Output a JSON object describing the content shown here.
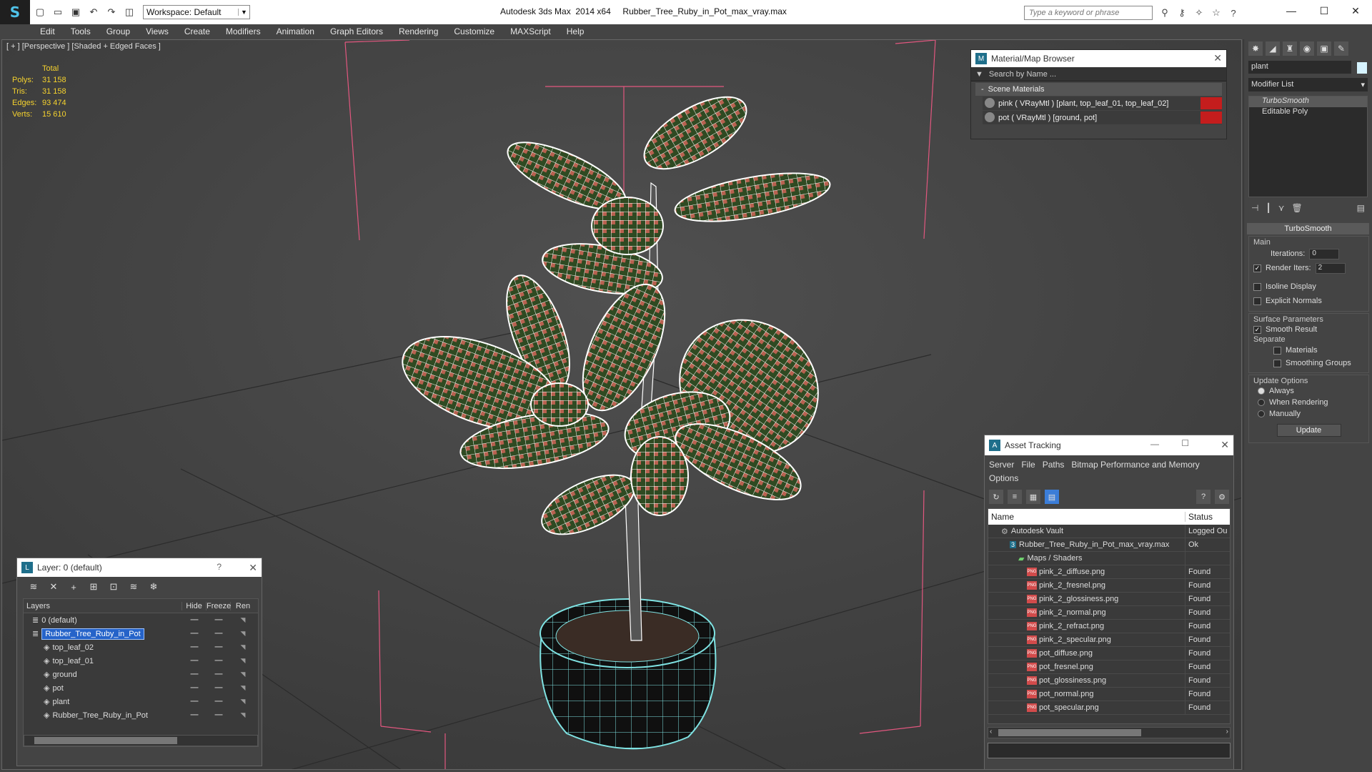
{
  "app": {
    "title": "Autodesk 3ds Max  2014 x64     Rubber_Tree_Ruby_in_Pot_max_vray.max",
    "workspace": "Workspace: Default",
    "search_placeholder": "Type a keyword or phrase"
  },
  "menu": [
    "Edit",
    "Tools",
    "Group",
    "Views",
    "Create",
    "Modifiers",
    "Animation",
    "Graph Editors",
    "Rendering",
    "Customize",
    "MAXScript",
    "Help"
  ],
  "viewport": {
    "label": "[ + ] [Perspective ] [Shaded + Edged Faces ]",
    "stats": {
      "total_label": "Total",
      "rows": [
        {
          "k": "Polys:",
          "v": "31 158"
        },
        {
          "k": "Tris:",
          "v": "31 158"
        },
        {
          "k": "Edges:",
          "v": "93 474"
        },
        {
          "k": "Verts:",
          "v": "15 610"
        }
      ]
    }
  },
  "material_browser": {
    "title": "Material/Map Browser",
    "search_placeholder": "Search by Name ...",
    "section": "Scene Materials",
    "items": [
      {
        "label": "pink  ( VRayMtl ) [plant, top_leaf_01, top_leaf_02]"
      },
      {
        "label": "pot  ( VRayMtl ) [ground, pot]"
      }
    ]
  },
  "command_panel": {
    "object_name": "plant",
    "modifier_list": "Modifier List",
    "stack": [
      "TurboSmooth",
      "Editable Poly"
    ],
    "rollout": "TurboSmooth",
    "main_label": "Main",
    "iterations_label": "Iterations:",
    "iterations": "0",
    "render_iters_label": "Render Iters:",
    "render_iters": "2",
    "isoline": "Isoline Display",
    "explicit": "Explicit Normals",
    "surface_label": "Surface Parameters",
    "smooth_result": "Smooth Result",
    "separate_label": "Separate",
    "materials": "Materials",
    "smoothing_groups": "Smoothing Groups",
    "update_label": "Update Options",
    "always": "Always",
    "when_rendering": "When Rendering",
    "manually": "Manually",
    "update_btn": "Update"
  },
  "asset_tracking": {
    "title": "Asset Tracking",
    "menu": [
      "Server",
      "File",
      "Paths",
      "Bitmap Performance and Memory"
    ],
    "menu2": "Options",
    "col_name": "Name",
    "col_status": "Status",
    "rows": [
      {
        "name": "Autodesk Vault",
        "status": "Logged Ou",
        "indent": 1,
        "icon": "vault"
      },
      {
        "name": "Rubber_Tree_Ruby_in_Pot_max_vray.max",
        "status": "Ok",
        "indent": 2,
        "icon": "max"
      },
      {
        "name": "Maps / Shaders",
        "status": "",
        "indent": 3,
        "icon": "maps"
      },
      {
        "name": "pink_2_diffuse.png",
        "status": "Found",
        "indent": 4,
        "icon": "png"
      },
      {
        "name": "pink_2_fresnel.png",
        "status": "Found",
        "indent": 4,
        "icon": "png"
      },
      {
        "name": "pink_2_glossiness.png",
        "status": "Found",
        "indent": 4,
        "icon": "png"
      },
      {
        "name": "pink_2_normal.png",
        "status": "Found",
        "indent": 4,
        "icon": "png"
      },
      {
        "name": "pink_2_refract.png",
        "status": "Found",
        "indent": 4,
        "icon": "png"
      },
      {
        "name": "pink_2_specular.png",
        "status": "Found",
        "indent": 4,
        "icon": "png"
      },
      {
        "name": "pot_diffuse.png",
        "status": "Found",
        "indent": 4,
        "icon": "png"
      },
      {
        "name": "pot_fresnel.png",
        "status": "Found",
        "indent": 4,
        "icon": "png"
      },
      {
        "name": "pot_glossiness.png",
        "status": "Found",
        "indent": 4,
        "icon": "png"
      },
      {
        "name": "pot_normal.png",
        "status": "Found",
        "indent": 4,
        "icon": "png"
      },
      {
        "name": "pot_specular.png",
        "status": "Found",
        "indent": 4,
        "icon": "png"
      }
    ]
  },
  "layers": {
    "title": "Layer: 0 (default)",
    "help": "?",
    "col_layers": "Layers",
    "col_hide": "Hide",
    "col_freeze": "Freeze",
    "col_render": "Ren",
    "rows": [
      {
        "name": "0 (default)",
        "indent": 1,
        "selected": false
      },
      {
        "name": "Rubber_Tree_Ruby_in_Pot",
        "indent": 1,
        "selected": true
      },
      {
        "name": "top_leaf_02",
        "indent": 2,
        "selected": false
      },
      {
        "name": "top_leaf_01",
        "indent": 2,
        "selected": false
      },
      {
        "name": "ground",
        "indent": 2,
        "selected": false
      },
      {
        "name": "pot",
        "indent": 2,
        "selected": false
      },
      {
        "name": "plant",
        "indent": 2,
        "selected": false
      },
      {
        "name": "Rubber_Tree_Ruby_in_Pot",
        "indent": 2,
        "selected": false
      }
    ]
  },
  "colors": {
    "stats": "#f5d22e",
    "selection": "#2563c9",
    "bbox": "#e2577f",
    "wire_plant": "#ffffff",
    "wire_pot": "#7fe3e3",
    "leaf_green": "#2f4a22",
    "leaf_pink": "#b8614f"
  }
}
